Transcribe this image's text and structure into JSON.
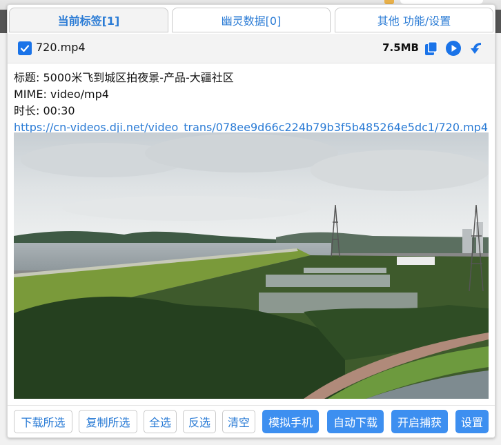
{
  "tabs": [
    {
      "label": "当前标签[1]"
    },
    {
      "label": "幽灵数据[0]"
    },
    {
      "label": "其他 功能/设置"
    }
  ],
  "item": {
    "filename": "720.mp4",
    "size": "7.5MB",
    "checked": true
  },
  "info": {
    "title": "标题: 5000米飞到城区拍夜景-产品-大疆社区",
    "mime": "MIME: video/mp4",
    "duration": "时长: 00:30",
    "url": "https://cn-videos.dji.net/video_trans/078ee9d66c224b79b3f5b485264e5dc1/720.mp4"
  },
  "buttons": {
    "download_selected": "下载所选",
    "copy_selected": "复制所选",
    "select_all": "全选",
    "invert_selection": "反选",
    "clear": "清空",
    "simulate_phone": "模拟手机",
    "auto_download": "自动下载",
    "start_capture": "开启捕获",
    "settings": "设置"
  },
  "colors": {
    "accent": "#2a7bd5",
    "primary_button": "#3d8ff0",
    "checkbox": "#1a73e8"
  },
  "icons": [
    "check-icon",
    "copy-icon",
    "play-icon",
    "download-icon"
  ]
}
